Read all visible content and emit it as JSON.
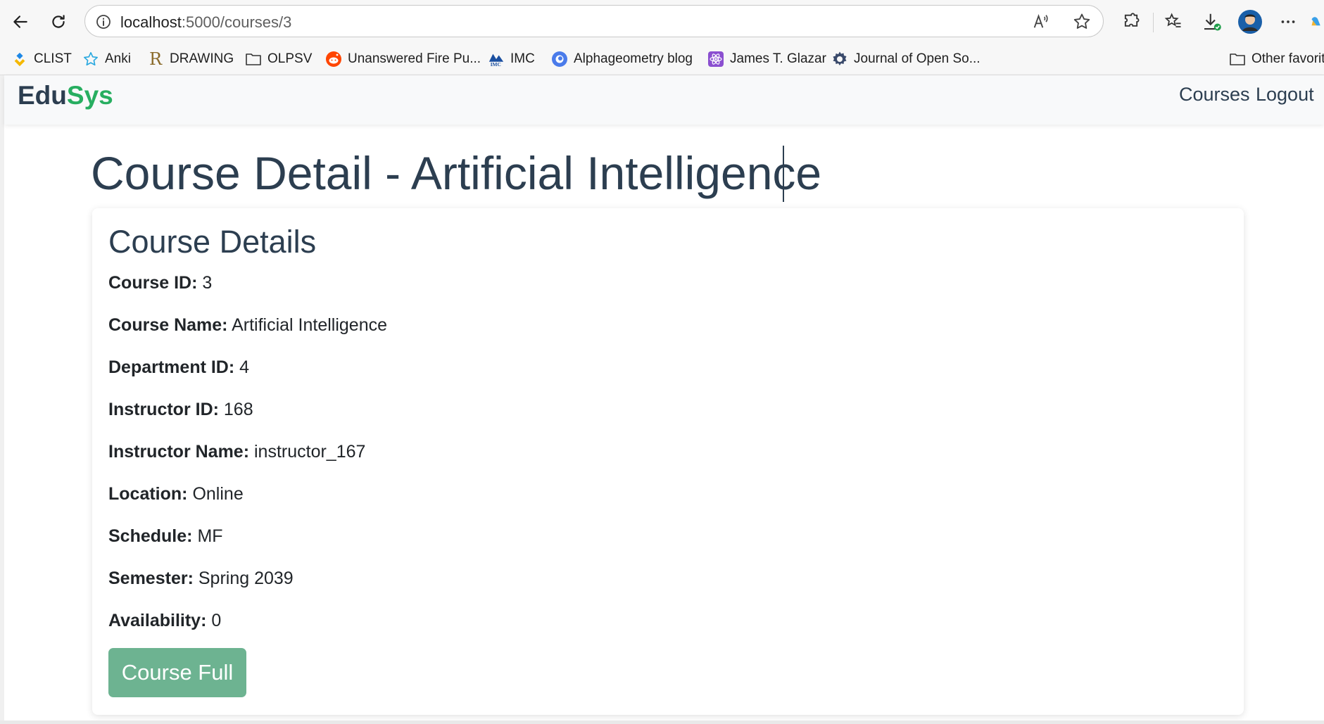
{
  "browser": {
    "url_host": "localhost",
    "url_path": ":5000/courses/3",
    "bookmarks": [
      {
        "label": "CLIST",
        "icon": "clist-icon"
      },
      {
        "label": "Anki",
        "icon": "anki-star-icon"
      },
      {
        "label": "DRAWING",
        "icon": "r-letter-icon"
      },
      {
        "label": "OLPSV",
        "icon": "folder-icon"
      },
      {
        "label": "Unanswered Fire Pu...",
        "icon": "reddit-icon"
      },
      {
        "label": "IMC",
        "icon": "imc-icon"
      },
      {
        "label": "Alphageometry blog",
        "icon": "blue-circle-icon"
      },
      {
        "label": "James T. Glazar",
        "icon": "react-atom-icon"
      },
      {
        "label": "Journal of Open So...",
        "icon": "gear-icon"
      },
      {
        "label": "Other favorit",
        "icon": "folder-icon"
      }
    ]
  },
  "navbar": {
    "brand_part1": "Edu",
    "brand_part2": "Sys",
    "links": [
      "Courses",
      "Logout"
    ]
  },
  "page": {
    "title": "Course Detail - Artificial Intelligence"
  },
  "card": {
    "heading": "Course Details",
    "fields": [
      {
        "label": "Course ID:",
        "value": "3"
      },
      {
        "label": "Course Name:",
        "value": "Artificial Intelligence"
      },
      {
        "label": "Department ID:",
        "value": "4"
      },
      {
        "label": "Instructor ID:",
        "value": "168"
      },
      {
        "label": "Instructor Name:",
        "value": "instructor_167"
      },
      {
        "label": "Location:",
        "value": "Online"
      },
      {
        "label": "Schedule:",
        "value": "MF"
      },
      {
        "label": "Semester:",
        "value": "Spring 2039"
      },
      {
        "label": "Availability:",
        "value": "0"
      }
    ],
    "button_label": "Course Full"
  },
  "colors": {
    "brand_green": "#27ae60",
    "text_dark": "#2c3e50",
    "button_green": "#6db391"
  }
}
